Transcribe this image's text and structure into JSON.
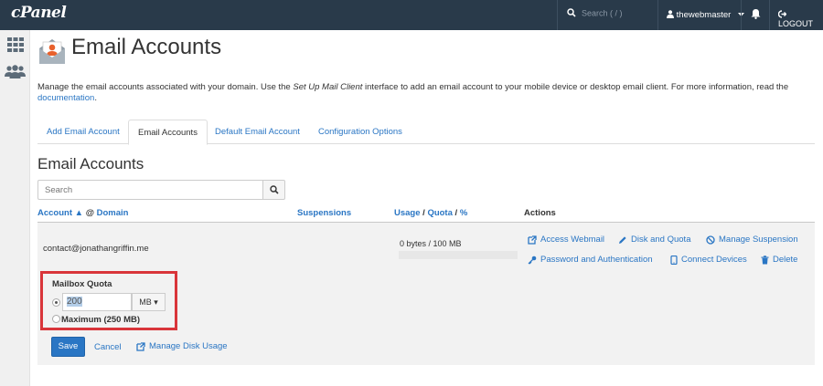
{
  "topbar": {
    "logo": "cPanel",
    "search_placeholder": "Search ( / )",
    "username": "thewebmaster",
    "logout_label": "LOGOUT"
  },
  "header": {
    "title": "Email Accounts",
    "intro_1": "Manage the email accounts associated with your domain. Use the ",
    "intro_em": "Set Up Mail Client",
    "intro_2": " interface to add an email account to your mobile device or desktop email client. For more information, read the ",
    "intro_link": "documentation",
    "intro_end": "."
  },
  "tabs": [
    {
      "label": "Add Email Account"
    },
    {
      "label": "Email Accounts"
    },
    {
      "label": "Default Email Account"
    },
    {
      "label": "Configuration Options"
    }
  ],
  "section_title": "Email Accounts",
  "search": {
    "placeholder": "Search"
  },
  "table": {
    "col_account": "Account",
    "sort_arrow": "▲",
    "col_at": "@",
    "col_domain": "Domain",
    "col_suspensions": "Suspensions",
    "col_usage": "Usage",
    "col_slash1": "/",
    "col_quota": "Quota",
    "col_slash2": "/",
    "col_percent": "%",
    "col_actions": "Actions"
  },
  "row": {
    "email": "contact@jonathangriffin.me",
    "usage": "0 bytes / 100 MB",
    "usage_fraction": 0,
    "actions": {
      "access_webmail": "Access Webmail",
      "disk_quota": "Disk and Quota",
      "manage_suspension": "Manage Suspension",
      "password_auth": "Password and Authentication",
      "connect_devices": "Connect Devices",
      "delete": "Delete"
    }
  },
  "quota_form": {
    "label": "Mailbox Quota",
    "value": "200",
    "unit": "MB",
    "unit_caret": "▾",
    "maximum_label": "Maximum (250 MB)",
    "save_label": "Save",
    "cancel_label": "Cancel",
    "manage_disk_label": "Manage Disk Usage"
  },
  "colors": {
    "topbar": "#293a4a",
    "link": "#2a76c4",
    "highlight_border": "#d9353a",
    "save_button": "#2a76c4"
  }
}
